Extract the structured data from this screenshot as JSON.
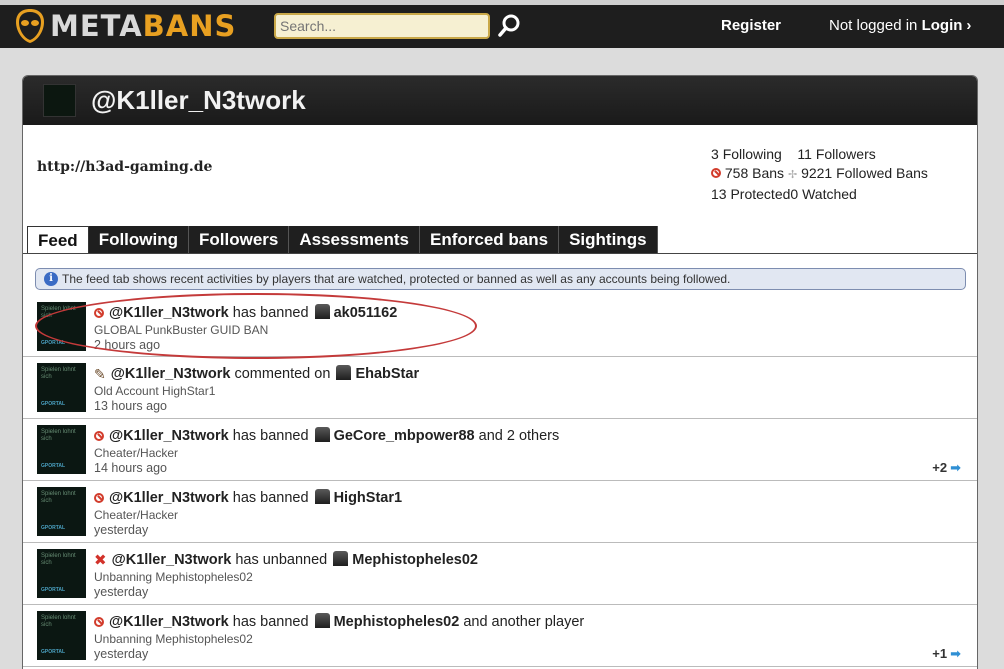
{
  "topbar": {
    "logo_meta": "META",
    "logo_bans": "BANS",
    "search_placeholder": "Search...",
    "register": "Register",
    "not_logged_in": "Not logged in",
    "login": "Login"
  },
  "profile": {
    "title": "@K1ller_N3twork",
    "website": "http://h3ad-gaming.de",
    "following_count": "3",
    "following_label": "Following",
    "followers_count": "11",
    "followers_label": "Followers",
    "bans_count": "758",
    "bans_label": "Bans",
    "followed_bans_count": "9221",
    "followed_bans_label": "Followed Bans",
    "protected_count": "13",
    "protected_label": "Protected",
    "watched_count": "0",
    "watched_label": "Watched"
  },
  "tabs": [
    {
      "label": "Feed"
    },
    {
      "label": "Following"
    },
    {
      "label": "Followers"
    },
    {
      "label": "Assessments"
    },
    {
      "label": "Enforced bans"
    },
    {
      "label": "Sightings"
    }
  ],
  "info": "The feed tab shows recent activities by players that are watched, protected or banned as well as any accounts being followed.",
  "feed": [
    {
      "icon": "ban-icon",
      "actor": "@K1ller_N3twork",
      "action": "has banned",
      "target": "ak051162",
      "suffix": "",
      "reason": "GLOBAL PunkBuster GUID BAN",
      "time": "2 hours ago",
      "more": ""
    },
    {
      "icon": "comment-icon",
      "actor": "@K1ller_N3twork",
      "action": "commented on",
      "target": "EhabStar",
      "suffix": "",
      "reason": "Old Account HighStar1",
      "time": "13 hours ago",
      "more": ""
    },
    {
      "icon": "ban-icon",
      "actor": "@K1ller_N3twork",
      "action": "has banned",
      "target": "GeCore_mbpower88",
      "suffix": "and 2 others",
      "reason": "Cheater/Hacker",
      "time": "14 hours ago",
      "more": "+2"
    },
    {
      "icon": "ban-icon",
      "actor": "@K1ller_N3twork",
      "action": "has banned",
      "target": "HighStar1",
      "suffix": "",
      "reason": "Cheater/Hacker",
      "time": "yesterday",
      "more": ""
    },
    {
      "icon": "unban-icon",
      "actor": "@K1ller_N3twork",
      "action": "has unbanned",
      "target": "Mephistopheles02",
      "suffix": "",
      "reason": "Unbanning Mephistopheles02",
      "time": "yesterday",
      "more": ""
    },
    {
      "icon": "ban-icon",
      "actor": "@K1ller_N3twork",
      "action": "has banned",
      "target": "Mephistopheles02",
      "suffix": "and another player",
      "reason": "Unbanning Mephistopheles02",
      "time": "yesterday",
      "more": "+1"
    }
  ],
  "avatar_text": {
    "top": "Spielen lohnt sich",
    "bottom": "GPORTAL"
  }
}
